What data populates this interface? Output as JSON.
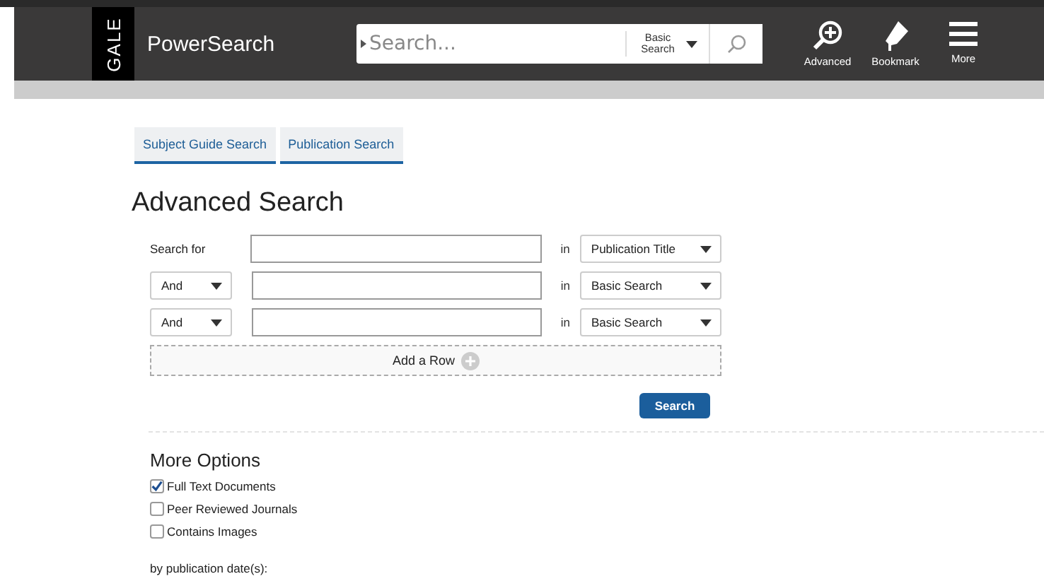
{
  "header": {
    "logo": "GALE",
    "title": "PowerSearch",
    "search": {
      "placeholder": "Search...",
      "mode": "Basic Search"
    },
    "actions": [
      {
        "label": "Advanced",
        "kind": "advanced"
      },
      {
        "label": "Bookmark",
        "kind": "bookmark"
      },
      {
        "label": "More",
        "kind": "more"
      }
    ]
  },
  "tabs": [
    {
      "label": "Subject Guide Search",
      "selected": false
    },
    {
      "label": "Publication Search",
      "selected": false
    }
  ],
  "title": "Advanced Search",
  "rows": [
    {
      "kind": "label",
      "operator": "Search for",
      "in": "in",
      "field": "Publication Title"
    },
    {
      "kind": "select",
      "operator": "And",
      "in": "in",
      "field": "Basic Search"
    },
    {
      "kind": "select",
      "operator": "And",
      "in": "in",
      "field": "Basic Search"
    }
  ],
  "add_row": "Add a Row",
  "search_button": "Search",
  "more_options": {
    "title": "More Options",
    "options": [
      {
        "label": "Full Text Documents",
        "checked": true
      },
      {
        "label": "Peer Reviewed Journals",
        "checked": false
      },
      {
        "label": "Contains Images",
        "checked": false
      }
    ]
  },
  "date_label": "by publication date(s):"
}
